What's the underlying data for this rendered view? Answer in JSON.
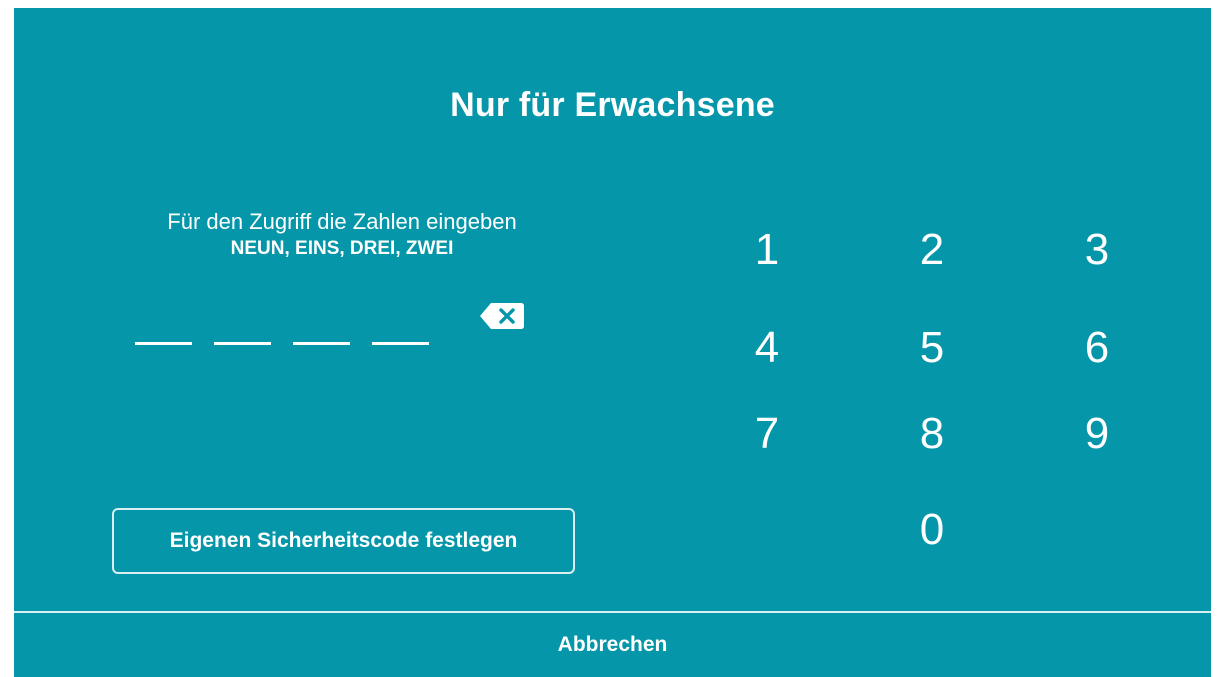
{
  "dialog": {
    "title": "Nur für Erwachsene",
    "instruction_line1": "Für den Zugriff die Zahlen eingeben",
    "instruction_line2": "NEUN, EINS, DREI, ZWEI",
    "backspace_icon": "backspace-icon",
    "code_slots_filled": 0,
    "set_code_label": "Eigenen Sicherheitscode festlegen",
    "cancel_label": "Abbrechen"
  },
  "keypad": {
    "keys": [
      "1",
      "2",
      "3",
      "4",
      "5",
      "6",
      "7",
      "8",
      "9",
      "0"
    ]
  },
  "colors": {
    "background": "#0596a9",
    "foreground": "#ffffff"
  }
}
